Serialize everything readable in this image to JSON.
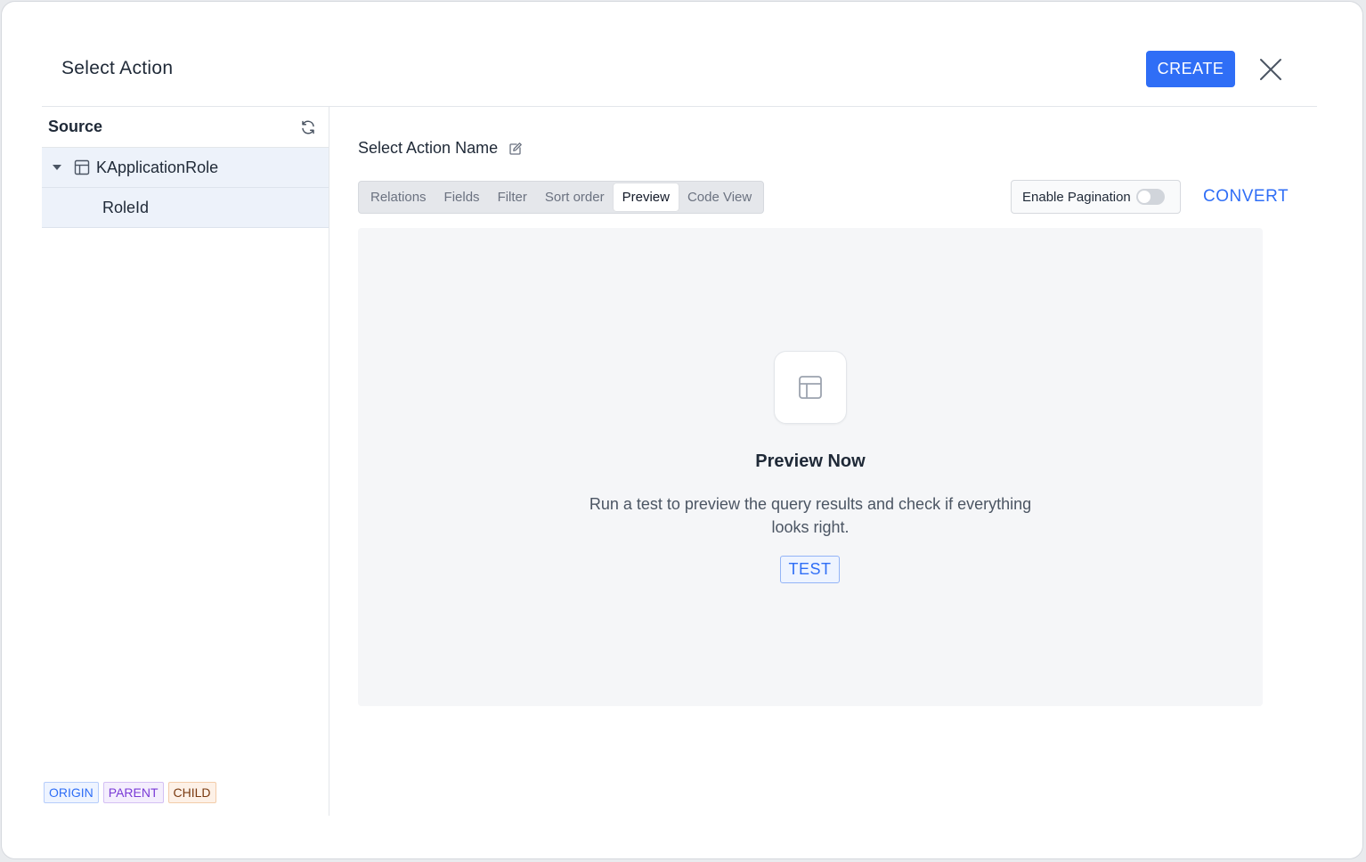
{
  "header": {
    "title": "Select Action",
    "create_label": "CREATE"
  },
  "sidebar": {
    "title": "Source",
    "tree": [
      {
        "label": "KApplicationRole",
        "icon": "table-icon",
        "expanded": true
      },
      {
        "label": "RoleId"
      }
    ],
    "legend": [
      "ORIGIN",
      "PARENT",
      "CHILD"
    ]
  },
  "main": {
    "action_name": "Select Action Name",
    "tabs": [
      {
        "label": "Relations"
      },
      {
        "label": "Fields"
      },
      {
        "label": "Filter"
      },
      {
        "label": "Sort order"
      },
      {
        "label": "Preview",
        "active": true
      },
      {
        "label": "Code View"
      }
    ],
    "pagination_label": "Enable Pagination",
    "pagination_enabled": false,
    "convert_label": "CONVERT",
    "preview": {
      "title": "Preview Now",
      "description": "Run a test to preview the query results and check if everything looks right.",
      "test_label": "TEST"
    }
  },
  "colors": {
    "accent": "#2f6ef6",
    "origin": "#2f6ef6",
    "parent": "#7a3bd6",
    "child": "#7a3a10"
  }
}
